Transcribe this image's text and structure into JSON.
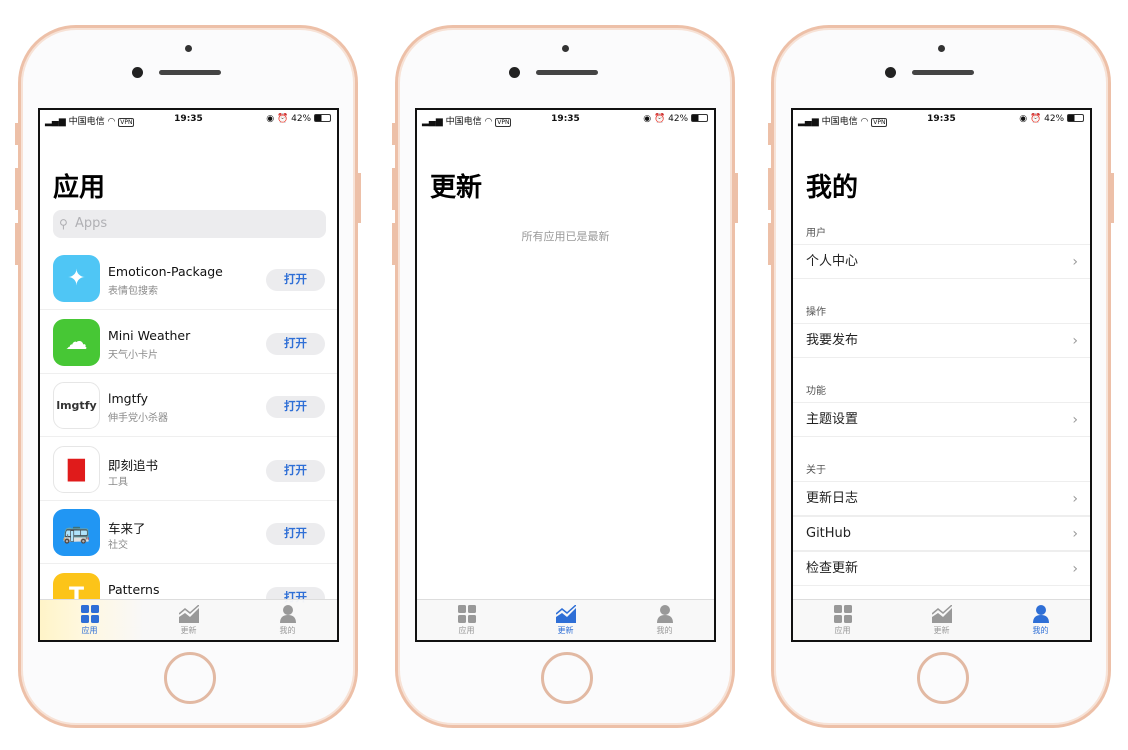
{
  "status": {
    "carrier": "中国电信",
    "vpn": "VPN",
    "time": "19:35",
    "battery": "42%"
  },
  "tabs": [
    {
      "label": "应用",
      "icon": "grid-icon"
    },
    {
      "label": "更新",
      "icon": "chart-icon"
    },
    {
      "label": "我的",
      "icon": "person-icon"
    }
  ],
  "accent": "#2f6fd6",
  "apps_screen": {
    "title": "应用",
    "search_placeholder": "Apps",
    "open_label": "打开",
    "apps": [
      {
        "name": "Emoticon-Package",
        "subtitle": "表情包搜索",
        "icon": "magic-wand-icon",
        "color": "#4fc6f5"
      },
      {
        "name": "Mini Weather",
        "subtitle": "天气小卡片",
        "icon": "cloud-sun-icon",
        "color": "#47c735"
      },
      {
        "name": "lmgtfy",
        "subtitle": "伸手党小杀器",
        "icon": "lmgtfy-logo",
        "color": "#ffffff"
      },
      {
        "name": "即刻追书",
        "subtitle": "工具",
        "icon": "book-icon",
        "color": "#ffffff"
      },
      {
        "name": "车来了",
        "subtitle": "社交",
        "icon": "bus-icon",
        "color": "#2196f3"
      },
      {
        "name": "Patterns",
        "subtitle": "",
        "icon": "letter-t-icon",
        "color": "#fcc419"
      }
    ]
  },
  "updates_screen": {
    "title": "更新",
    "empty_text": "所有应用已是最新"
  },
  "me_screen": {
    "title": "我的",
    "sections": [
      {
        "label": "用户",
        "items": [
          "个人中心"
        ]
      },
      {
        "label": "操作",
        "items": [
          "我要发布"
        ]
      },
      {
        "label": "功能",
        "items": [
          "主题设置"
        ]
      },
      {
        "label": "关于",
        "items": [
          "更新日志",
          "GitHub",
          "检查更新"
        ]
      }
    ]
  }
}
